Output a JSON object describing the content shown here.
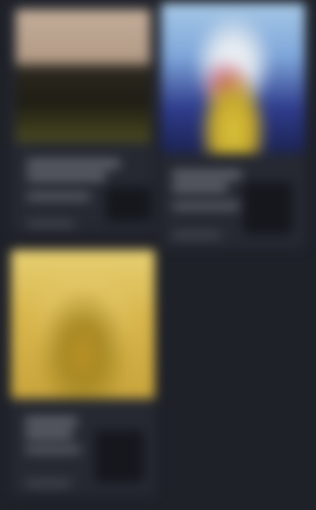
{
  "grid": {
    "cards": [
      {
        "id": "card-1",
        "cover_palette": [
          "#b39b86",
          "#2d2a1c",
          "#6a6a2a"
        ]
      },
      {
        "id": "card-2",
        "cover_palette": [
          "#9ec6e6",
          "#3a4a9b",
          "#d8c13a"
        ]
      },
      {
        "id": "card-3",
        "cover_palette": [
          "#d5b34b",
          "#b3922f",
          "#e3c468"
        ]
      }
    ]
  }
}
